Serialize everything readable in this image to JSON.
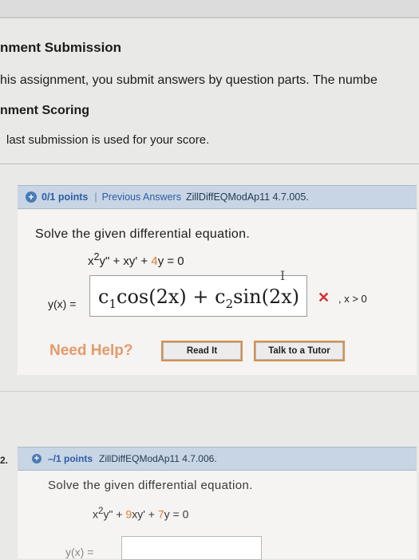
{
  "header": {
    "title": "nment Submission",
    "notice": "his assignment, you submit answers by question parts. The numbe",
    "scoring_title": "nment Scoring",
    "scoring_text": "last submission is used for your score."
  },
  "question1": {
    "points": "0/1 points",
    "separator": "|",
    "previous_answers": "Previous Answers",
    "code": "ZillDiffEQModAp11 4.7.005.",
    "prompt": "Solve the given differential equation.",
    "equation": {
      "part1": "x",
      "part2": "2",
      "part3": "y\" + xy' + ",
      "part4": "4",
      "part5": "y = 0"
    },
    "answer_label": "y(x) =",
    "answer_value": {
      "c1": "c",
      "sub1": "1",
      "cos": "cos",
      "arg1": "(2x)",
      "plus": " + ",
      "c2": "c",
      "sub2": "2",
      "sin": "sin",
      "arg2": "(2x)"
    },
    "status_mark": "✕",
    "condition": ", x > 0",
    "need_help": "Need Help?",
    "read_it": "Read It",
    "talk_to_tutor": "Talk to a Tutor"
  },
  "question2": {
    "number": "2.",
    "points": "–/1 points",
    "code": "ZillDiffEQModAp11 4.7.006.",
    "prompt": "Solve the given differential equation.",
    "equation": {
      "part1": "x",
      "part2": "2",
      "part3": "y\" + ",
      "part4": "9",
      "part5": "xy' + ",
      "part6": "7",
      "part7": "y = 0"
    },
    "answer_label": "y(x) ="
  },
  "colors": {
    "header_bg": "#c7d5e4",
    "link": "#2f5ca8",
    "wrong": "#d62e2e",
    "help": "#e59a6a",
    "button_border": "#d88f4a"
  }
}
